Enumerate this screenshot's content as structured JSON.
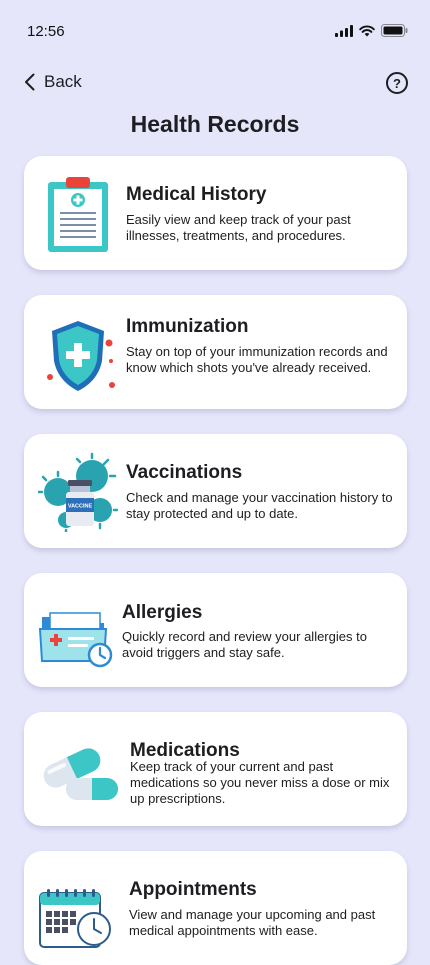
{
  "status": {
    "time": "12:56"
  },
  "nav": {
    "back_label": "Back",
    "help_label": "?"
  },
  "page": {
    "title": "Health Records"
  },
  "cards": [
    {
      "title": "Medical History",
      "desc": "Easily view and keep track of your past illnesses, treatments, and procedures."
    },
    {
      "title": "Immunization",
      "desc": "Stay on top of your immunization records and know which shots you've already received."
    },
    {
      "title": "Vaccinations",
      "desc": "Check and manage your vaccination history to stay protected and up to date."
    },
    {
      "title": "Allergies",
      "desc": "Quickly record and review your allergies to avoid triggers and stay safe."
    },
    {
      "title": "Medications",
      "desc": "Keep track of your current and past medications so you never miss a dose or mix up prescriptions."
    },
    {
      "title": "Appointments",
      "desc": "View and manage your upcoming and past medical appointments with ease."
    }
  ],
  "vaccine_label": "VACCINE",
  "colors": {
    "background": "#e6e6fb",
    "accent": "#3cc6c6",
    "alert": "#e8443a",
    "text": "#1e1e22"
  }
}
